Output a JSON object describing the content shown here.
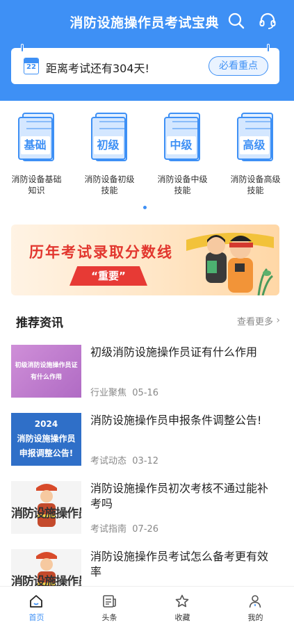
{
  "header": {
    "title": "消防设施操作员考试宝典",
    "icons": [
      "search-icon",
      "headset-icon"
    ],
    "bg_color": "#3e90f5"
  },
  "countdown": {
    "calendar_day": "22",
    "text": "距离考试还有304天!",
    "button": "必看重点"
  },
  "categories": [
    {
      "badge": "基础",
      "name_line1": "消防设备基础",
      "name_line2": "知识"
    },
    {
      "badge": "初级",
      "name_line1": "消防设备初级",
      "name_line2": "技能"
    },
    {
      "badge": "中级",
      "name_line1": "消防设备中级",
      "name_line2": "技能"
    },
    {
      "badge": "高级",
      "name_line1": "消防设备高级",
      "name_line2": "技能"
    }
  ],
  "banner": {
    "title": "历年考试录取分数线",
    "tag": "“重要”"
  },
  "section": {
    "title": "推荐资讯",
    "more": "查看更多"
  },
  "news": [
    {
      "thumb_line1": "初级消防设施操作员证",
      "thumb_line2": "有什么作用",
      "title": "初级消防设施操作员证有什么作用",
      "category": "行业聚焦",
      "date": "05-16"
    },
    {
      "thumb_line1": "2024",
      "thumb_line2": "消防设施操作员",
      "thumb_line3": "申报调整公告!",
      "title": "消防设施操作员申报条件调整公告!",
      "category": "考试动态",
      "date": "03-12"
    },
    {
      "thumb_text": "消防设施操作员",
      "title": "消防设施操作员初次考核不通过能补考吗",
      "category": "考试指南",
      "date": "07-26"
    },
    {
      "thumb_text": "消防设施操作员",
      "title": "消防设施操作员考试怎么备考更有效率",
      "category": "",
      "date": ""
    }
  ],
  "bottom_nav": [
    {
      "label": "首页",
      "icon": "home-icon",
      "active": true
    },
    {
      "label": "头条",
      "icon": "news-icon",
      "active": false
    },
    {
      "label": "收藏",
      "icon": "star-icon",
      "active": false
    },
    {
      "label": "我的",
      "icon": "user-icon",
      "active": false
    }
  ],
  "colors": {
    "accent": "#3e90f5",
    "banner_red": "#e2362e"
  }
}
